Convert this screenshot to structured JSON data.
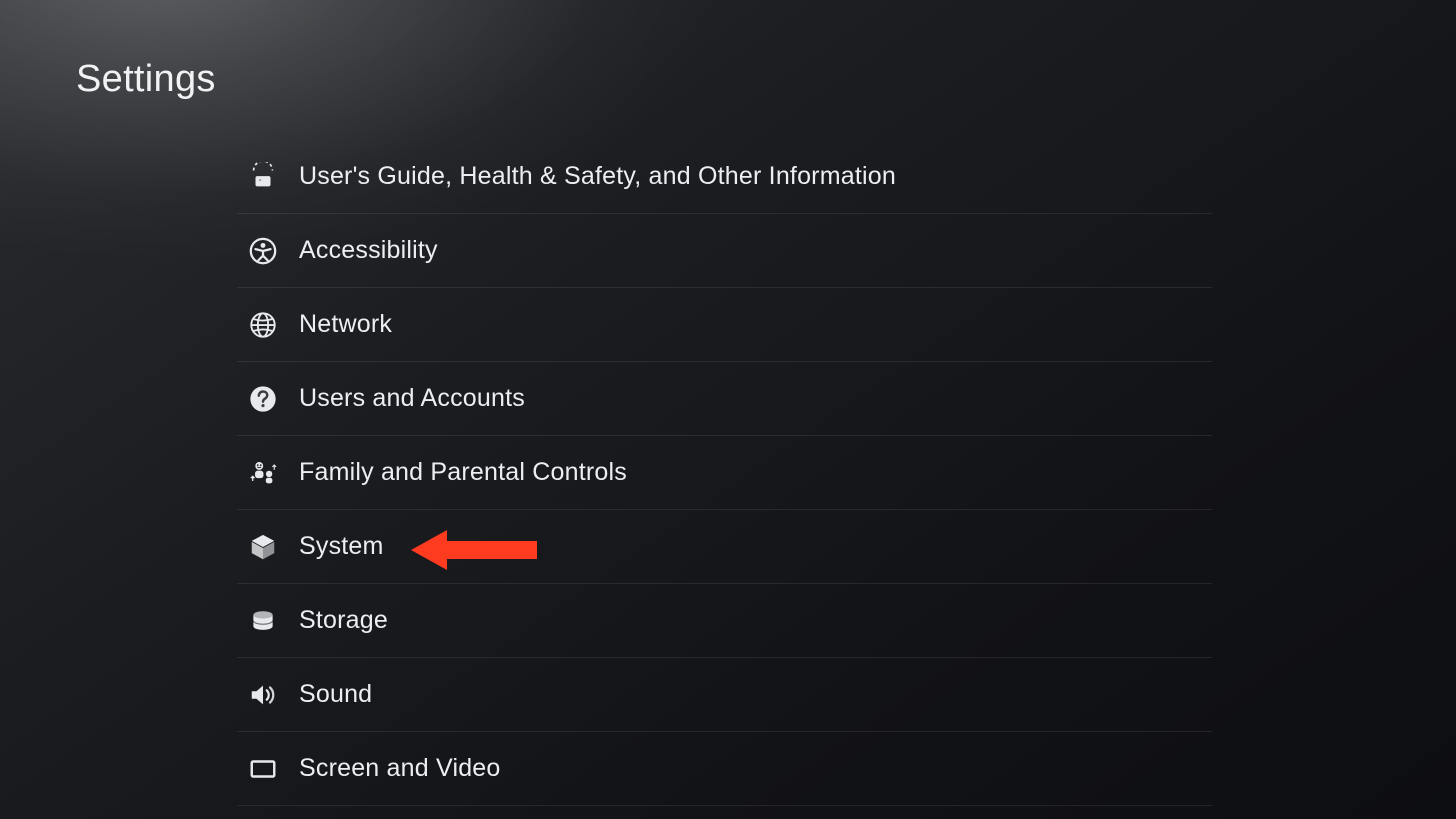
{
  "header": {
    "title": "Settings"
  },
  "menu": {
    "items": [
      {
        "label": "User's Guide, Health & Safety, and Other Information",
        "iconName": "guide-icon"
      },
      {
        "label": "Accessibility",
        "iconName": "accessibility-icon"
      },
      {
        "label": "Network",
        "iconName": "globe-icon"
      },
      {
        "label": "Users and Accounts",
        "iconName": "question-circle-icon"
      },
      {
        "label": "Family and Parental Controls",
        "iconName": "family-icon"
      },
      {
        "label": "System",
        "iconName": "cube-icon",
        "highlighted": true
      },
      {
        "label": "Storage",
        "iconName": "storage-icon"
      },
      {
        "label": "Sound",
        "iconName": "sound-icon"
      },
      {
        "label": "Screen and Video",
        "iconName": "screen-icon"
      }
    ]
  },
  "annotation": {
    "type": "arrow-left",
    "target_index": 5,
    "color": "#ff3b1f"
  }
}
